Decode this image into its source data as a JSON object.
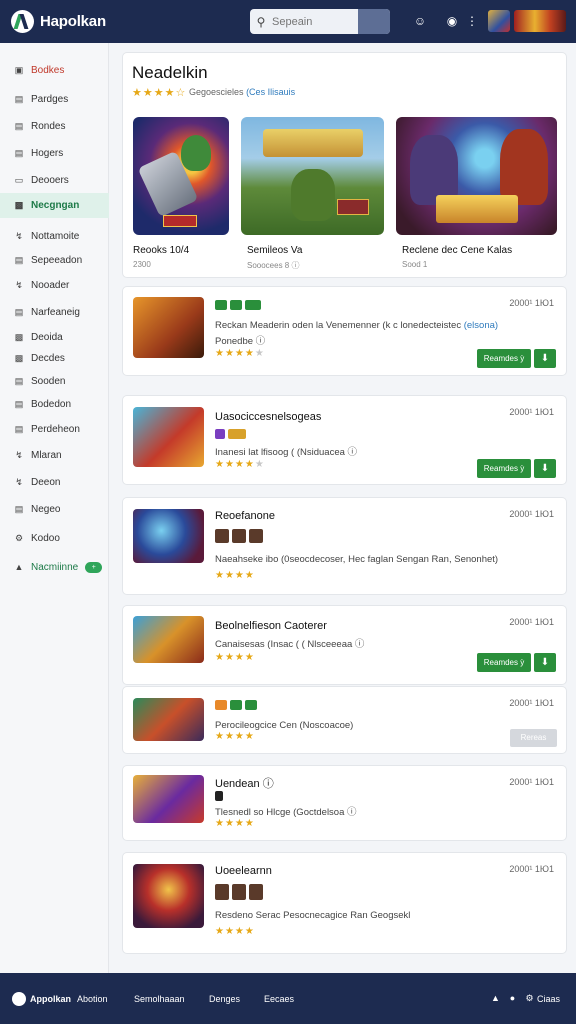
{
  "header": {
    "app_title": "Hapolkan",
    "search_placeholder": "Sepeain",
    "icons": [
      "search-icon",
      "smiley-icon",
      "notification-icon",
      "more-icon"
    ]
  },
  "sidebar": {
    "items": [
      {
        "label": "Bodkes",
        "icon": "gamepad-icon"
      },
      {
        "label": "Pardges",
        "icon": "list-icon"
      },
      {
        "label": "Rondes",
        "icon": "list-icon"
      },
      {
        "label": "Hogers",
        "icon": "list-icon"
      },
      {
        "label": "Deooers",
        "icon": "folder-icon"
      },
      {
        "label": "Necgngan",
        "icon": "grid-icon"
      },
      {
        "label": "Nottamoite",
        "icon": "link-icon"
      },
      {
        "label": "Sepeeadon",
        "icon": "list-icon"
      },
      {
        "label": "Nooader",
        "icon": "link-icon"
      },
      {
        "label": "Narfeaneig",
        "icon": "list-icon"
      },
      {
        "label": "Deoida",
        "icon": "grid-icon"
      },
      {
        "label": "Decdes",
        "icon": "grid-icon"
      },
      {
        "label": "Sooden",
        "icon": "list-icon"
      },
      {
        "label": "Bodedon",
        "icon": "list-icon"
      },
      {
        "label": "Perdeheon",
        "icon": "list-icon"
      },
      {
        "label": "Mlaran",
        "icon": "link-icon"
      },
      {
        "label": "Deeon",
        "icon": "link-icon"
      },
      {
        "label": "Negeo",
        "icon": "list-icon"
      },
      {
        "label": "Kodoo",
        "icon": "settings-icon"
      },
      {
        "label": "Nacmiinne",
        "icon": "folder-icon",
        "badge": "+"
      }
    ]
  },
  "featured": {
    "title": "Neadelkin",
    "rating_stars": "★★★★☆",
    "subtitle": "Gegoescieles",
    "subtitle_tag": "(Ces Ilisauis",
    "games": [
      {
        "name": "Reooks 10/4",
        "meta": "2300"
      },
      {
        "name": "Semileos Va",
        "meta": "Sooocees 8 ⓘ"
      },
      {
        "name": "Reclene dec Cene Kalas",
        "meta": "Sood 1"
      }
    ]
  },
  "list": [
    {
      "title": "",
      "desc": "Reckan Meaderin oden la Venemenner (k c lonedecteistec",
      "desc_link": "(elsona)",
      "sub": "Ponedbe ⓘ",
      "date": "2000¹ 1Ю1",
      "rating": "★★★★",
      "rating_off": "★",
      "button": "Reamdes ỳ",
      "button2": "⬇"
    },
    {
      "title": "Uasociccesnelsogeas",
      "desc": "Inanesi lat lfisoog ( (Nsiduacea ⓘ",
      "sub": "",
      "date": "2000¹ 1Ю1",
      "rating": "★★★★",
      "rating_off": "★",
      "button": "Reamdes ỳ",
      "button2": "⬇"
    },
    {
      "title": "Reoefanone",
      "desc": "Naeahseke ibo (0seocdecoser, Hec faglan Sengan Ran, Senonhet)",
      "sub": "",
      "date": "2000¹ 1Ю1",
      "rating": "★★★★",
      "rating_off": "",
      "button": "",
      "button2": ""
    },
    {
      "title": "Beolnelfieson Caoterer",
      "desc": "Canaisesas (Insac ( ( Nlsceeeaa ⓘ",
      "sub": "",
      "date": "2000¹ 1Ю1",
      "rating": "★★★★",
      "rating_off": "",
      "button": "Reamdes ỳ",
      "button2": "⬇"
    },
    {
      "title": "",
      "desc": "Perocileogcice Cen (Noscoacoe)",
      "sub": "★★★★",
      "date": "2000¹ 1Ю1",
      "rating": "",
      "rating_off": "",
      "button": "Rereas",
      "button2": ""
    },
    {
      "title": "Uendean ⓘ",
      "desc": "Tlesnedl so Hlcge (Goctdelsoa ⓘ",
      "sub": "",
      "date": "2000¹ 1Ю1",
      "rating": "★★★★",
      "rating_off": "",
      "button": "",
      "button2": ""
    },
    {
      "title": "Uoeelearnn",
      "desc": "Resdeno Serac Pesocnecagice Ran Geogsekl",
      "sub": "",
      "date": "2000¹ 1Ю1",
      "rating": "★★★★",
      "rating_off": "",
      "button": "",
      "button2": ""
    }
  ],
  "footer": {
    "brand": "Appolkan",
    "links": [
      "Abotion",
      "Semolhaaan",
      "Denges",
      "Eecaes"
    ],
    "right_label": "Ciaas"
  },
  "colors": {
    "header_bg": "#1d2b50",
    "accent_green": "#2a8f3b",
    "active_nav_bg": "#dff1ea",
    "star": "#e6a817",
    "link_blue": "#2f7bbd"
  }
}
